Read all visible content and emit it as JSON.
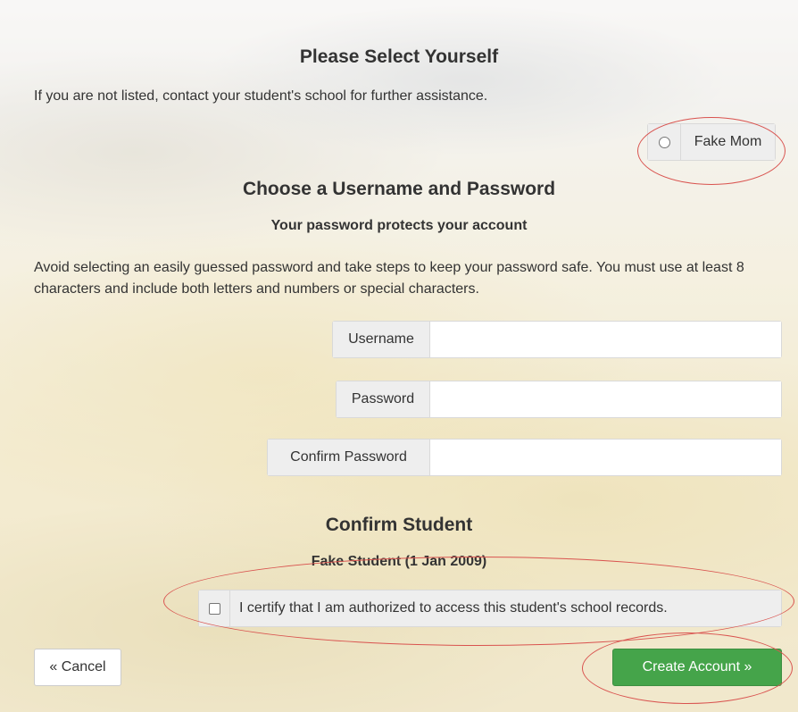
{
  "select_section": {
    "title": "Please Select Yourself",
    "help": "If you are not listed, contact your student's school for further assistance.",
    "options": [
      {
        "label": "Fake Mom",
        "checked": false
      }
    ]
  },
  "credentials_section": {
    "title": "Choose a Username and Password",
    "subtitle": "Your password protects your account",
    "help": "Avoid selecting an easily guessed password and take steps to keep your password safe. You must use at least 8 characters and include both letters and numbers or special characters.",
    "username_label": "Username",
    "username_value": "",
    "password_label": "Password",
    "password_value": "",
    "confirm_label": "Confirm Password",
    "confirm_value": ""
  },
  "confirm_section": {
    "title": "Confirm Student",
    "student": "Fake Student (1 Jan 2009)",
    "certify_label": "I certify that I am authorized to access this student's school records.",
    "certify_checked": false
  },
  "buttons": {
    "cancel": "« Cancel",
    "create": "Create Account »"
  },
  "colors": {
    "primary_button": "#45a44a",
    "highlight_ring": "#d9534f"
  }
}
